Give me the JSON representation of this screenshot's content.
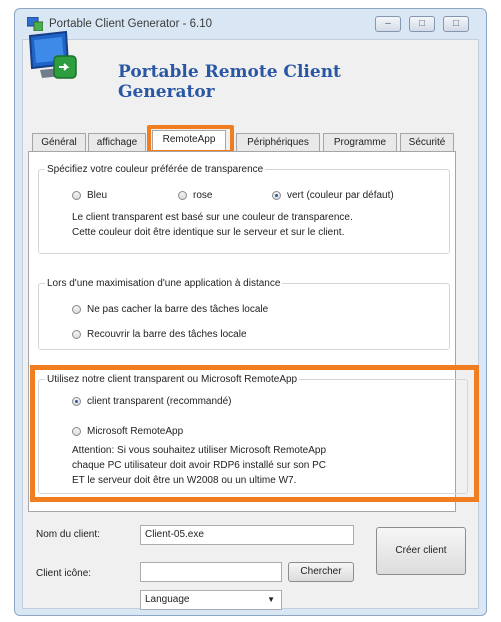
{
  "window": {
    "title": "Portable Client Generator - 6.10",
    "header": "Portable Remote Client Generator"
  },
  "tabs": [
    "Général",
    "affichage",
    "RemoteApp",
    "Périphériques",
    "Programme",
    "Sécurité"
  ],
  "active_tab": "RemoteApp",
  "group_transparency": {
    "legend": "Spécifiez votre couleur préférée de transparence",
    "options": [
      "Bleu",
      "rose",
      "vert (couleur par défaut)"
    ],
    "selected": "vert (couleur par défaut)",
    "note_lines": [
      "Le client transparent est basé sur une couleur de transparence.",
      "Cette couleur doit être identique sur le serveur et sur le client."
    ]
  },
  "group_maximize": {
    "legend": "Lors d'une maximisation d'une application à distance",
    "options": [
      "Ne pas cacher la barre des tâches locale",
      "Recouvrir la barre des tâches locale"
    ]
  },
  "group_client_type": {
    "legend": "Utilisez notre client transparent ou Microsoft RemoteApp",
    "options": [
      "client transparent (recommandé)",
      "Microsoft RemoteApp"
    ],
    "selected": "client transparent (recommandé)",
    "note_lines": [
      "Attention: Si vous souhaitez utiliser Microsoft RemoteApp",
      "chaque PC utilisateur doit avoir RDP6 installé sur son PC",
      "ET le serveur doit être un W2008 ou un ultime W7."
    ]
  },
  "footer": {
    "client_name_label": "Nom du client:",
    "client_name_value": "Client-05.exe",
    "client_icon_label": "Client icône:",
    "client_icon_value": "",
    "browse_button": "Chercher",
    "create_button": "Créer client",
    "language_select": "Language"
  },
  "colors": {
    "highlight": "#f07d1f",
    "title_blue": "#2a57a5"
  },
  "icons": [
    "app-icon",
    "monitor-logo-icon",
    "minimize-icon",
    "maximize-icon",
    "close-icon",
    "dropdown-arrow-icon"
  ]
}
